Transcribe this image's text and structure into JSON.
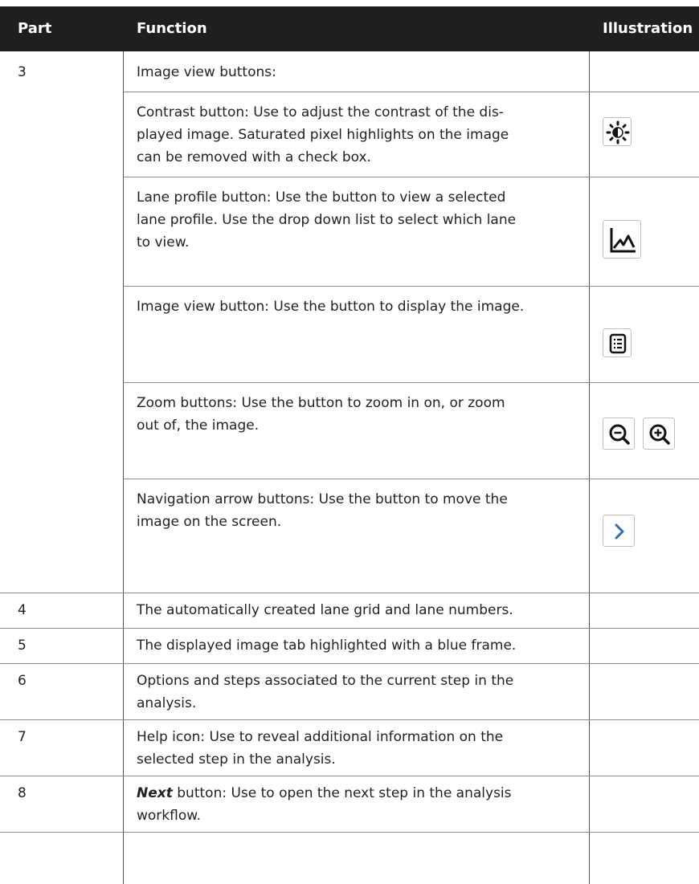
{
  "header": {
    "part": "Part",
    "function": "Function",
    "illustration": "Illustration"
  },
  "rows": [
    {
      "part": "3",
      "function": "Image view buttons:"
    },
    {
      "part": "",
      "function": "Contrast button: Use to adjust the contrast of the dis-played image. Saturated pixel highlights on the image can be removed with a check box.",
      "lines": [
        "Contrast button: Use to adjust the contrast of the dis-",
        "played image. Saturated pixel highlights on the image",
        "can be removed with a check box."
      ],
      "icon": "contrast-icon"
    },
    {
      "part": "",
      "lines": [
        "Lane profile button: Use the button to view a selected",
        "lane profile. Use the drop down list to select which lane",
        "to view."
      ],
      "icon": "lane-profile-icon"
    },
    {
      "part": "",
      "lines": [
        "Image view button: Use the button to display the image."
      ],
      "icon": "image-view-icon"
    },
    {
      "part": "",
      "lines": [
        "Zoom buttons: Use the button to zoom in on, or zoom",
        "out of, the image."
      ],
      "icons": [
        "zoom-out-icon",
        "zoom-in-icon"
      ]
    },
    {
      "part": "",
      "lines": [
        "Navigation arrow buttons: Use the button to move the",
        "image on the screen."
      ],
      "icon": "chevron-right-icon"
    },
    {
      "part": "4",
      "lines": [
        "The automatically created lane grid and lane numbers."
      ]
    },
    {
      "part": "5",
      "lines": [
        "The displayed image tab highlighted with a blue frame."
      ]
    },
    {
      "part": "6",
      "lines": [
        "Options and steps associated to the current step in the",
        "analysis."
      ]
    },
    {
      "part": "7",
      "lines": [
        "Help icon: Use to reveal additional information on the",
        "selected step in the analysis."
      ]
    },
    {
      "part": "8",
      "lines": [
        "button: Use to open the next step in the analysis",
        "workflow."
      ],
      "bold_italic_prefix": "Next"
    }
  ],
  "colors": {
    "header_bg": "#1f1f1f",
    "arrow": "#2a6fb8"
  }
}
